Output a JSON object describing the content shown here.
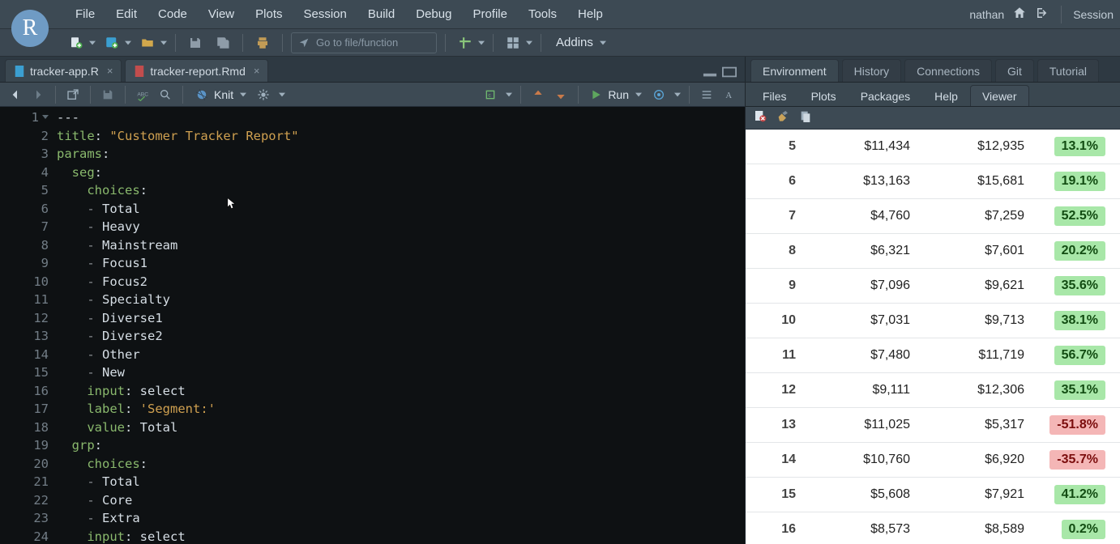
{
  "user": "nathan",
  "session_label": "Session",
  "menu": [
    "File",
    "Edit",
    "Code",
    "View",
    "Plots",
    "Session",
    "Build",
    "Debug",
    "Profile",
    "Tools",
    "Help"
  ],
  "toolbar": {
    "goto_placeholder": "Go to file/function",
    "addins_label": "Addins"
  },
  "editor_tabs": [
    {
      "name": "tracker-app.R",
      "active": false,
      "icon": "r-icon"
    },
    {
      "name": "tracker-report.Rmd",
      "active": true,
      "icon": "rmd-icon"
    }
  ],
  "editor_toolbar": {
    "knit": "Knit",
    "run": "Run"
  },
  "code_lines": [
    {
      "n": 1,
      "text": "---",
      "fold": true
    },
    {
      "n": 2,
      "html": "<span class='tok-key'>title</span>: <span class='tok-str'>\"Customer Tracker Report\"</span>"
    },
    {
      "n": 3,
      "html": "<span class='tok-key'>params</span>:"
    },
    {
      "n": 4,
      "html": "  <span class='tok-key'>seg</span>:"
    },
    {
      "n": 5,
      "html": "    <span class='tok-key'>choices</span>:"
    },
    {
      "n": 6,
      "html": "    <span class='tok-dash'>-</span> Total"
    },
    {
      "n": 7,
      "html": "    <span class='tok-dash'>-</span> Heavy"
    },
    {
      "n": 8,
      "html": "    <span class='tok-dash'>-</span> Mainstream"
    },
    {
      "n": 9,
      "html": "    <span class='tok-dash'>-</span> Focus1"
    },
    {
      "n": 10,
      "html": "    <span class='tok-dash'>-</span> Focus2"
    },
    {
      "n": 11,
      "html": "    <span class='tok-dash'>-</span> Specialty"
    },
    {
      "n": 12,
      "html": "    <span class='tok-dash'>-</span> Diverse1"
    },
    {
      "n": 13,
      "html": "    <span class='tok-dash'>-</span> Diverse2"
    },
    {
      "n": 14,
      "html": "    <span class='tok-dash'>-</span> Other"
    },
    {
      "n": 15,
      "html": "    <span class='tok-dash'>-</span> New"
    },
    {
      "n": 16,
      "html": "    <span class='tok-key'>input</span>: select"
    },
    {
      "n": 17,
      "html": "    <span class='tok-key'>label</span>: <span class='tok-str'>'Segment:'</span>"
    },
    {
      "n": 18,
      "html": "    <span class='tok-key'>value</span>: Total"
    },
    {
      "n": 19,
      "html": "  <span class='tok-key'>grp</span>:"
    },
    {
      "n": 20,
      "html": "    <span class='tok-key'>choices</span>:"
    },
    {
      "n": 21,
      "html": "    <span class='tok-dash'>-</span> Total"
    },
    {
      "n": 22,
      "html": "    <span class='tok-dash'>-</span> Core"
    },
    {
      "n": 23,
      "html": "    <span class='tok-dash'>-</span> Extra"
    },
    {
      "n": 24,
      "html": "    <span class='tok-key'>input</span>: select"
    }
  ],
  "env_tabs_upper": [
    "Environment",
    "History",
    "Connections",
    "Git",
    "Tutorial"
  ],
  "env_tabs_lower": [
    "Files",
    "Plots",
    "Packages",
    "Help",
    "Viewer"
  ],
  "env_lower_active": "Viewer",
  "viewer_table": [
    {
      "row": 5,
      "a": "$11,434",
      "b": "$12,935",
      "pct": "13.1%",
      "cls": "pos"
    },
    {
      "row": 6,
      "a": "$13,163",
      "b": "$15,681",
      "pct": "19.1%",
      "cls": "pos"
    },
    {
      "row": 7,
      "a": "$4,760",
      "b": "$7,259",
      "pct": "52.5%",
      "cls": "pos"
    },
    {
      "row": 8,
      "a": "$6,321",
      "b": "$7,601",
      "pct": "20.2%",
      "cls": "pos"
    },
    {
      "row": 9,
      "a": "$7,096",
      "b": "$9,621",
      "pct": "35.6%",
      "cls": "pos"
    },
    {
      "row": 10,
      "a": "$7,031",
      "b": "$9,713",
      "pct": "38.1%",
      "cls": "pos"
    },
    {
      "row": 11,
      "a": "$7,480",
      "b": "$11,719",
      "pct": "56.7%",
      "cls": "pos"
    },
    {
      "row": 12,
      "a": "$9,111",
      "b": "$12,306",
      "pct": "35.1%",
      "cls": "pos"
    },
    {
      "row": 13,
      "a": "$11,025",
      "b": "$5,317",
      "pct": "-51.8%",
      "cls": "neg"
    },
    {
      "row": 14,
      "a": "$10,760",
      "b": "$6,920",
      "pct": "-35.7%",
      "cls": "neg"
    },
    {
      "row": 15,
      "a": "$5,608",
      "b": "$7,921",
      "pct": "41.2%",
      "cls": "pos"
    },
    {
      "row": 16,
      "a": "$8,573",
      "b": "$8,589",
      "pct": "0.2%",
      "cls": "pos"
    }
  ]
}
